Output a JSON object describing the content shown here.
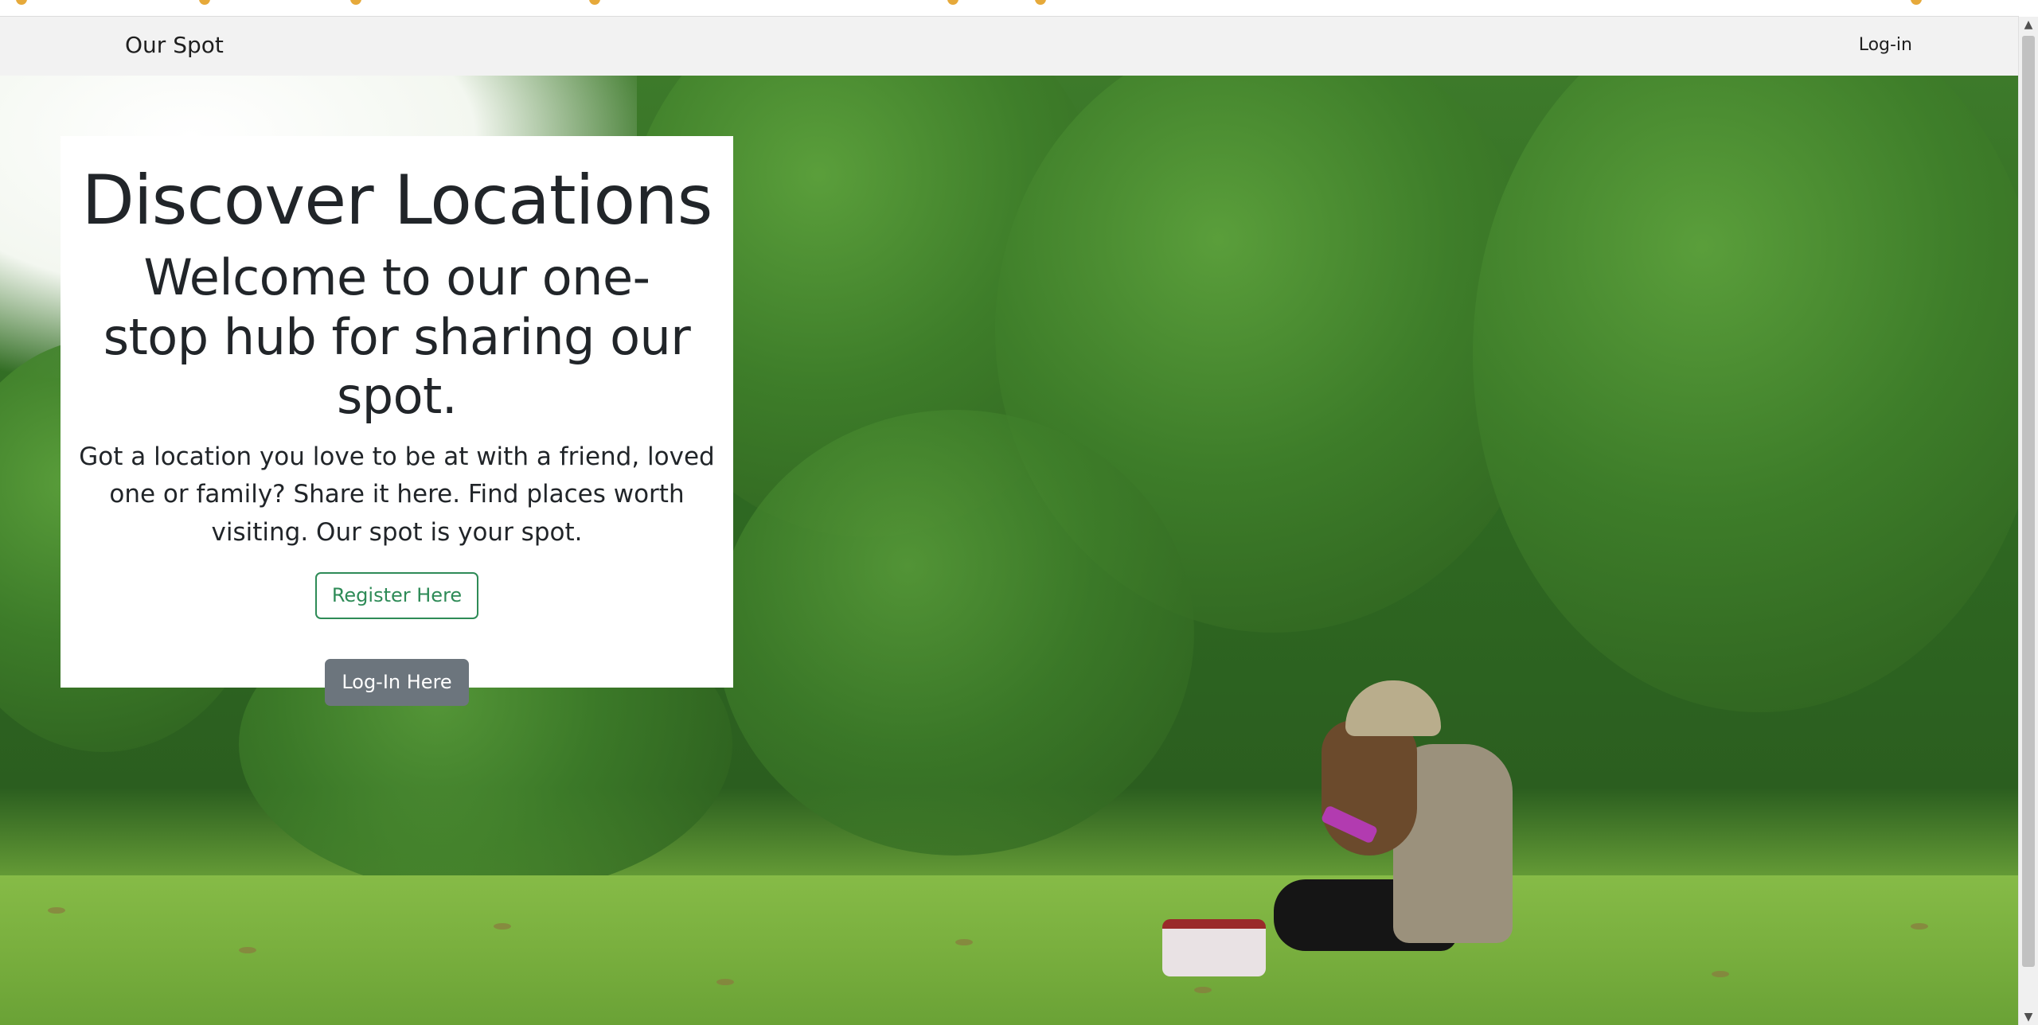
{
  "navbar": {
    "brand": "Our Spot",
    "login_link": "Log-in"
  },
  "hero": {
    "title": "Discover Locations",
    "subtitle": "Welcome to our one-stop hub for sharing our spot.",
    "description": "Got a location you love to be at with a friend, loved one or family? Share it here. Find places worth visiting. Our spot is your spot.",
    "register_button": "Register Here",
    "login_button": "Log-In Here"
  },
  "colors": {
    "navbar_bg": "#f2f2f2",
    "register_accent": "#2e8b57",
    "login_button_bg": "#6c757d",
    "text": "#212529"
  },
  "icons": {
    "scroll_up": "scroll-up-arrow-icon",
    "scroll_down": "scroll-down-arrow-icon"
  },
  "scroll_up_glyph": "▲",
  "scroll_down_glyph": "▼"
}
